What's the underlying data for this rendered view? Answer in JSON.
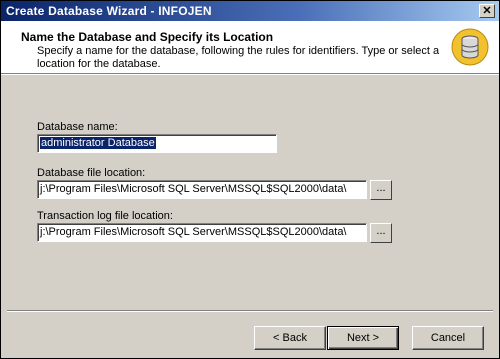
{
  "window": {
    "title": "Create Database Wizard - INFOJEN",
    "close_glyph": "✕"
  },
  "header": {
    "title": "Name the Database and Specify its Location",
    "subtitle": "Specify a name for the database, following the rules for identifiers. Type or select a location for the database.",
    "icon": "database-icon"
  },
  "form": {
    "db_name_label": "Database name:",
    "db_name_value": "administrator Database",
    "db_file_label": "Database file location:",
    "db_file_value": "j:\\Program Files\\Microsoft SQL Server\\MSSQL$SQL2000\\data\\",
    "log_file_label": "Transaction log file location:",
    "log_file_value": "j:\\Program Files\\Microsoft SQL Server\\MSSQL$SQL2000\\data\\",
    "browse_label": "..."
  },
  "buttons": {
    "back": "< Back",
    "next": "Next >",
    "cancel": "Cancel"
  },
  "colors": {
    "titlebar_start": "#0a246a",
    "titlebar_end": "#a6caf0",
    "selection": "#0a246a",
    "dialog_face": "#d4d0c8"
  }
}
